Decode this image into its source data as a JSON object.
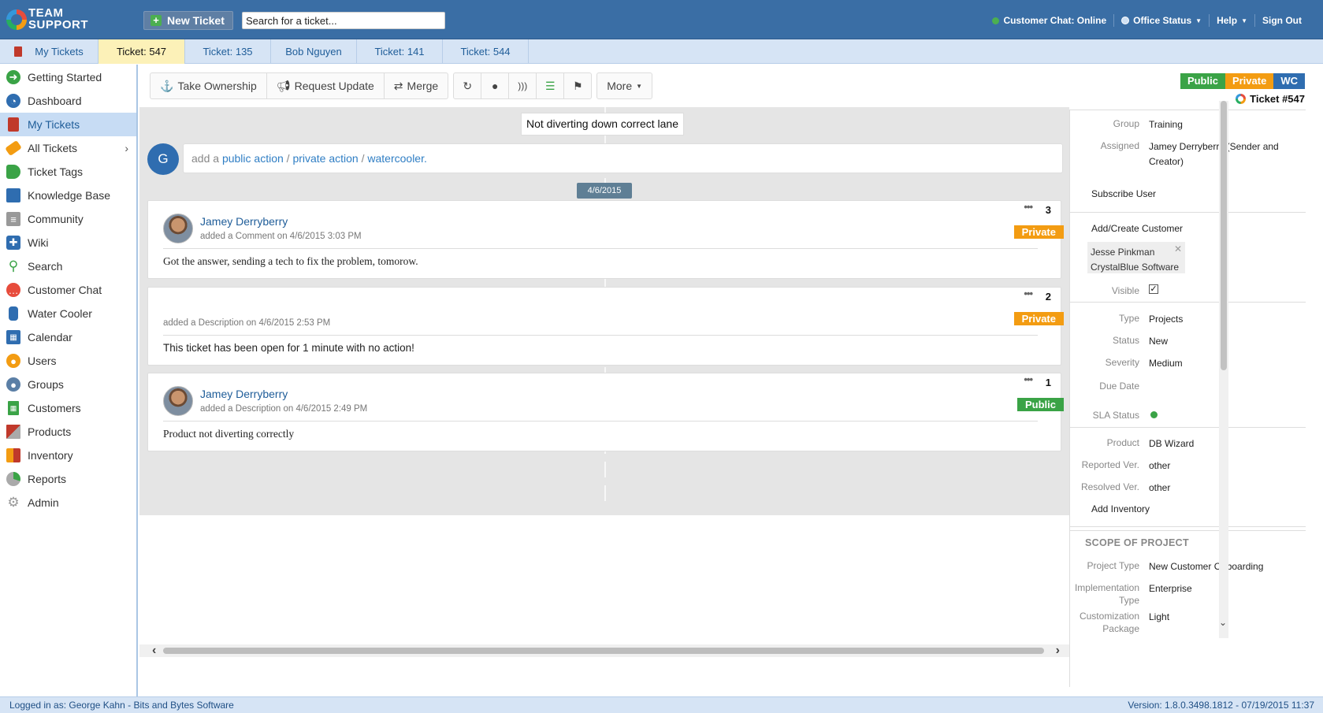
{
  "header": {
    "logo_line1": "TEAM",
    "logo_line2": "SUPPORT",
    "new_ticket_label": "New Ticket",
    "search_placeholder": "Search for a ticket...",
    "customer_chat": "Customer Chat: Online",
    "office_status": "Office Status",
    "help": "Help",
    "sign_out": "Sign Out"
  },
  "tabs": [
    {
      "label": "My Tickets"
    },
    {
      "label": "Ticket: 547"
    },
    {
      "label": "Ticket: 135"
    },
    {
      "label": "Bob Nguyen"
    },
    {
      "label": "Ticket: 141"
    },
    {
      "label": "Ticket: 544"
    }
  ],
  "sidebar": {
    "items": [
      {
        "label": "Getting Started",
        "icon": "arrow-right-circle-icon"
      },
      {
        "label": "Dashboard",
        "icon": "gauge-icon"
      },
      {
        "label": "My Tickets",
        "icon": "book-icon"
      },
      {
        "label": "All Tickets",
        "icon": "ticket-icon"
      },
      {
        "label": "Ticket Tags",
        "icon": "tag-icon"
      },
      {
        "label": "Knowledge Base",
        "icon": "books-icon"
      },
      {
        "label": "Community",
        "icon": "newspaper-icon"
      },
      {
        "label": "Wiki",
        "icon": "puzzle-icon"
      },
      {
        "label": "Search",
        "icon": "magnifier-icon"
      },
      {
        "label": "Customer Chat",
        "icon": "chat-icon"
      },
      {
        "label": "Water Cooler",
        "icon": "water-cooler-icon"
      },
      {
        "label": "Calendar",
        "icon": "calendar-icon"
      },
      {
        "label": "Users",
        "icon": "user-icon"
      },
      {
        "label": "Groups",
        "icon": "group-icon"
      },
      {
        "label": "Customers",
        "icon": "building-icon"
      },
      {
        "label": "Products",
        "icon": "boxes-icon"
      },
      {
        "label": "Inventory",
        "icon": "forklift-icon"
      },
      {
        "label": "Reports",
        "icon": "pie-chart-icon"
      },
      {
        "label": "Admin",
        "icon": "gears-icon"
      }
    ]
  },
  "toolbar": {
    "take_ownership": "Take Ownership",
    "request_update": "Request Update",
    "merge": "Merge",
    "more": "More"
  },
  "ticket": {
    "subject": "Not diverting down correct lane",
    "add_action_prefix": "add a",
    "public_action": "public action",
    "private_action": "private action",
    "watercooler": "watercooler.",
    "sep": "/",
    "date": "4/6/2015",
    "user_initial": "G"
  },
  "actions": [
    {
      "num": "3",
      "author": "Jamey Derryberry",
      "meta": "added a Comment on 4/6/2015 3:03 PM",
      "badge": "Private",
      "body": "Got the answer, sending a tech to fix the problem, tomorow."
    },
    {
      "num": "2",
      "author": "",
      "meta": "added a Description on 4/6/2015 2:53 PM",
      "badge": "Private",
      "body": "This ticket has been open for 1 minute with no action!"
    },
    {
      "num": "1",
      "author": "Jamey Derryberry",
      "meta": "added a Description on 4/6/2015 2:49 PM",
      "badge": "Public",
      "body": "Product not diverting correctly"
    }
  ],
  "visibility": {
    "public": "Public",
    "private": "Private",
    "wc": "WC"
  },
  "ticket_number": "Ticket #547",
  "properties": {
    "group_label": "Group",
    "group": "Training",
    "assigned_label": "Assigned",
    "assigned": "Jamey Derryberry (Sender and Creator)",
    "subscribe_user": "Subscribe User",
    "add_customer": "Add/Create Customer",
    "customer_name": "Jesse Pinkman",
    "customer_company": "CrystalBlue Software",
    "visible_label": "Visible",
    "type_label": "Type",
    "type": "Projects",
    "status_label": "Status",
    "status": "New",
    "severity_label": "Severity",
    "severity": "Medium",
    "due_date_label": "Due Date",
    "sla_label": "SLA Status",
    "product_label": "Product",
    "product": "DB Wizard",
    "reported_label": "Reported Ver.",
    "reported": "other",
    "resolved_label": "Resolved Ver.",
    "resolved": "other",
    "add_inventory": "Add Inventory",
    "scope_title": "SCOPE OF PROJECT",
    "project_type_label": "Project Type",
    "project_type": "New Customer Onboarding",
    "impl_type_label": "Implementation Type",
    "impl_type": "Enterprise",
    "custom_pkg_label": "Customization Package",
    "custom_pkg": "Light"
  },
  "statusbar": {
    "logged_in": "Logged in as: George Kahn - Bits and Bytes Software",
    "version": "Version: 1.8.0.3498.1812 - 07/19/2015 11:37"
  },
  "colors": {
    "header_bg": "#3a6ea5",
    "tab_active": "#fcf1b8",
    "private": "#f39c12",
    "public": "#3aa346",
    "wc": "#2f6db0"
  }
}
